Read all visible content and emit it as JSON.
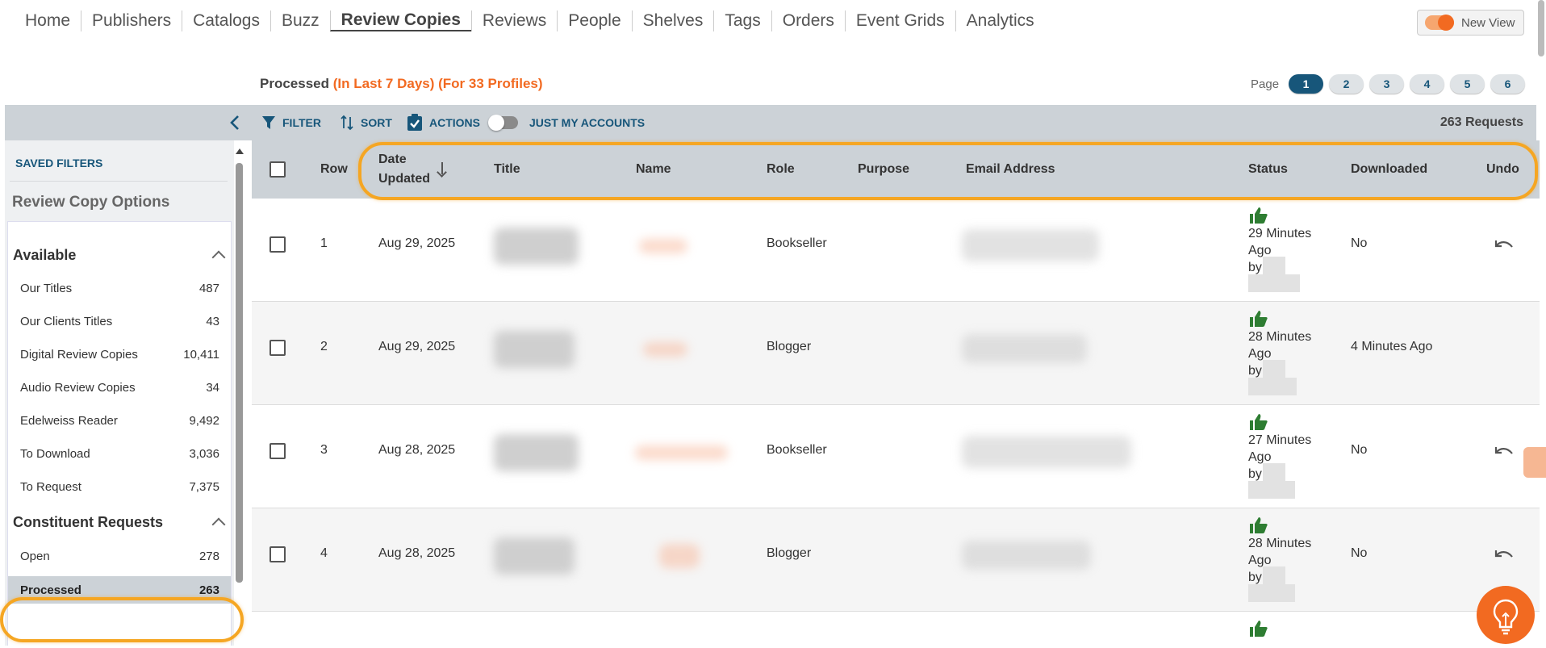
{
  "nav": {
    "items": [
      "Home",
      "Publishers",
      "Catalogs",
      "Buzz",
      "Review Copies",
      "Reviews",
      "People",
      "Shelves",
      "Tags",
      "Orders",
      "Event Grids",
      "Analytics"
    ],
    "active": "Review Copies",
    "new_view": "New View"
  },
  "header": {
    "title": "Processed",
    "range": "(In Last 7 Days)",
    "profiles": "(For 33 Profiles)"
  },
  "pager": {
    "label": "Page",
    "pages": [
      "1",
      "2",
      "3",
      "4",
      "5",
      "6"
    ],
    "current": "1"
  },
  "toolbar": {
    "filter": "FILTER",
    "sort": "SORT",
    "actions": "ACTIONS",
    "just_my_accounts": "JUST MY ACCOUNTS",
    "requests": "263 Requests"
  },
  "sidebar": {
    "saved_filters": "SAVED FILTERS",
    "options_title": "Review Copy Options",
    "available": {
      "title": "Available",
      "items": [
        {
          "label": "Our Titles",
          "count": "487"
        },
        {
          "label": "Our Clients Titles",
          "count": "43"
        },
        {
          "label": "Digital Review Copies",
          "count": "10,411"
        },
        {
          "label": "Audio Review Copies",
          "count": "34"
        },
        {
          "label": "Edelweiss Reader",
          "count": "9,492"
        },
        {
          "label": "To Download",
          "count": "3,036"
        },
        {
          "label": "To Request",
          "count": "7,375"
        }
      ]
    },
    "constituent": {
      "title": "Constituent Requests",
      "items": [
        {
          "label": "Open",
          "count": "278"
        },
        {
          "label": "Processed",
          "count": "263"
        }
      ]
    }
  },
  "table": {
    "columns": {
      "row": "Row",
      "date_updated": "Date Updated",
      "title": "Title",
      "name": "Name",
      "role": "Role",
      "purpose": "Purpose",
      "email": "Email Address",
      "status": "Status",
      "downloaded": "Downloaded",
      "undo": "Undo"
    },
    "rows": [
      {
        "row": "1",
        "date": "Aug 29, 2025",
        "role": "Bookseller",
        "status_time": "29 Minutes",
        "status_ago": "Ago",
        "status_by": "by",
        "downloaded": "No",
        "undo": true
      },
      {
        "row": "2",
        "date": "Aug 29, 2025",
        "role": "Blogger",
        "status_time": "28 Minutes",
        "status_ago": "Ago",
        "status_by": "by",
        "downloaded": "4 Minutes Ago",
        "undo": false
      },
      {
        "row": "3",
        "date": "Aug 28, 2025",
        "role": "Bookseller",
        "status_time": "27 Minutes",
        "status_ago": "Ago",
        "status_by": "by",
        "downloaded": "No",
        "undo": true
      },
      {
        "row": "4",
        "date": "Aug 28, 2025",
        "role": "Blogger",
        "status_time": "28 Minutes",
        "status_ago": "Ago",
        "status_by": "by",
        "downloaded": "No",
        "undo": true
      }
    ]
  },
  "colors": {
    "accent": "#f26a21",
    "primary": "#17567a",
    "toolbar_bg": "#ccd2d7",
    "thumbs_up": "#2e7d32",
    "highlight": "#f5a623"
  },
  "icons": {
    "filter": "filter-icon",
    "sort": "sort-icon",
    "actions": "clipboard-check-icon",
    "collapse": "chevron-left-icon",
    "approved": "thumbs-up-icon",
    "undo": "undo-icon",
    "help": "lightbulb-icon"
  }
}
